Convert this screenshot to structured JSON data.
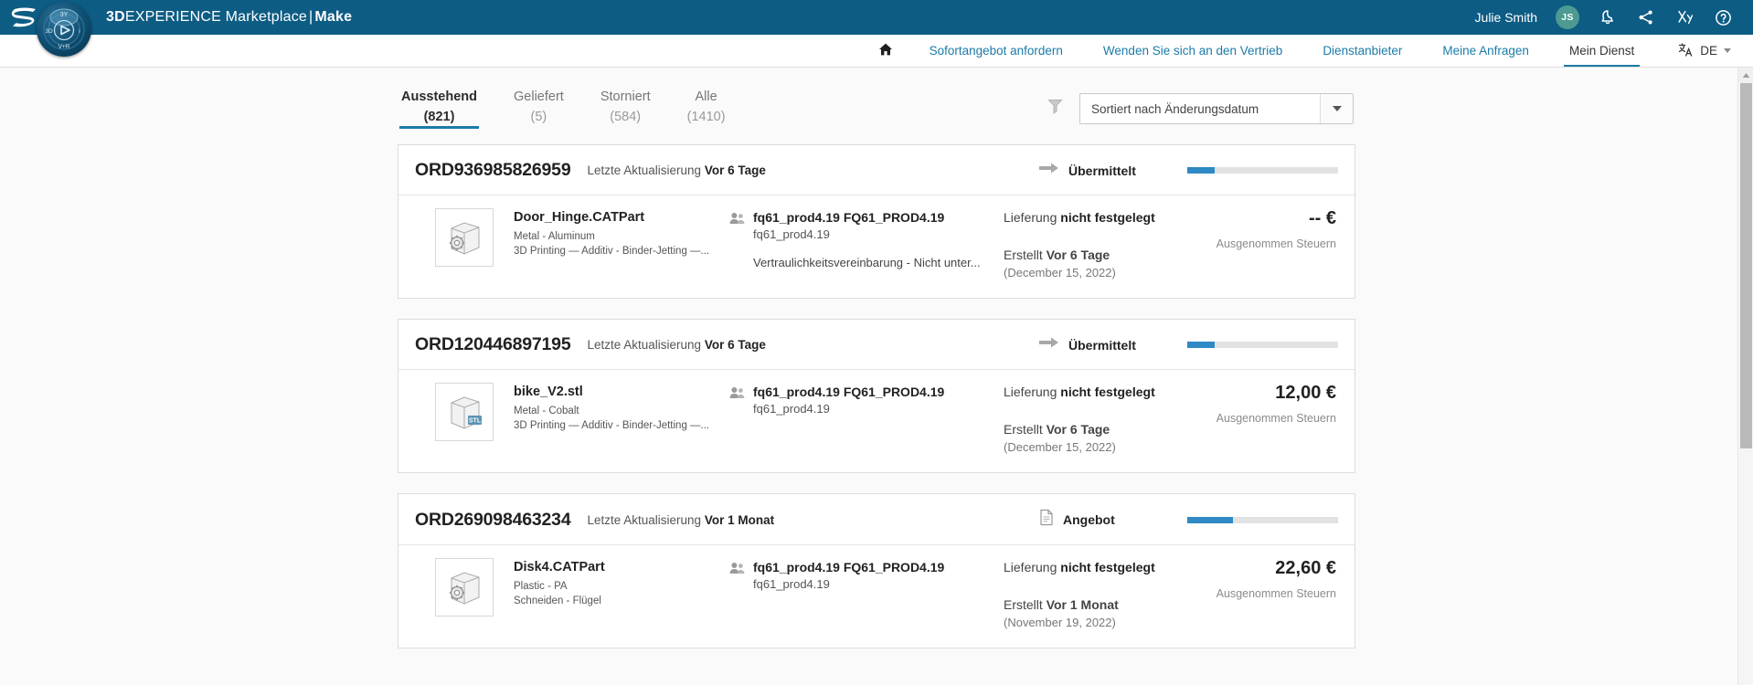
{
  "topbar": {
    "brand_bold": "3D",
    "brand_rest": "EXPERIENCE Marketplace",
    "brand_sep": "|",
    "brand_make": "Make",
    "compass_labels": {
      "top": "3Y",
      "left": "3D",
      "right": "i",
      "bottom": "V+R"
    },
    "user_name": "Julie Smith",
    "avatar_initials": "JS",
    "icons": [
      "notification-bell-icon",
      "share-icon",
      "collaboration-icon",
      "help-icon"
    ],
    "accent": "#0d5c84"
  },
  "nav": {
    "home_icon": "home-icon",
    "items": [
      {
        "label": "Sofortangebot anfordern",
        "active": false
      },
      {
        "label": "Wenden Sie sich an den Vertrieb",
        "active": false
      },
      {
        "label": "Dienstanbieter",
        "active": false
      },
      {
        "label": "Meine Anfragen",
        "active": false
      },
      {
        "label": "Mein Dienst",
        "active": true
      }
    ],
    "language": "DE",
    "language_icon": "translate-icon"
  },
  "tabs": [
    {
      "label": "Ausstehend",
      "count": "(821)",
      "active": true
    },
    {
      "label": "Geliefert",
      "count": "(5)",
      "active": false
    },
    {
      "label": "Storniert",
      "count": "(584)",
      "active": false
    },
    {
      "label": "Alle",
      "count": "(1410)",
      "active": false
    }
  ],
  "toolbar": {
    "filter_icon": "filter-funnel-icon",
    "sort_value": "Sortiert nach Änderungsdatum",
    "sort_placeholder": "Sortiert nach Änderungsdatum",
    "dropdown_icon": "chevron-down-icon"
  },
  "orders": [
    {
      "id": "ORD936985826959",
      "updated_prefix": "Letzte Aktualisierung",
      "updated_value": "Vor 6 Tage",
      "status_icon": "arrow-right-icon",
      "status": "Übermittelt",
      "progress_percent": 18,
      "thumb_icon": "cad-part-icon",
      "thumb_badge": "",
      "product_name": "Door_Hinge.CATPart",
      "material": "Metal - Aluminum",
      "process": "3D Printing — Additiv - Binder-Jetting —...",
      "customer_icon": "customers-icon",
      "customer_main": "fq61_prod4.19 FQ61_PROD4.19",
      "customer_sub": "fq61_prod4.19",
      "nda": "Vertraulichkeitsvereinbarung - Nicht unter...",
      "delivery_prefix": "Lieferung",
      "delivery_value": "nicht festgelegt",
      "created_prefix": "Erstellt",
      "created_value": "Vor 6 Tage",
      "created_date": "(December 15, 2022)",
      "price": "-- €",
      "price_note": "Ausgenommen Steuern"
    },
    {
      "id": "ORD120446897195",
      "updated_prefix": "Letzte Aktualisierung",
      "updated_value": "Vor 6 Tage",
      "status_icon": "arrow-right-icon",
      "status": "Übermittelt",
      "progress_percent": 18,
      "thumb_icon": "stl-part-icon",
      "thumb_badge": "STL",
      "product_name": "bike_V2.stl",
      "material": "Metal - Cobalt",
      "process": "3D Printing — Additiv - Binder-Jetting —...",
      "customer_icon": "customers-icon",
      "customer_main": "fq61_prod4.19 FQ61_PROD4.19",
      "customer_sub": "fq61_prod4.19",
      "nda": "",
      "delivery_prefix": "Lieferung",
      "delivery_value": "nicht festgelegt",
      "created_prefix": "Erstellt",
      "created_value": "Vor 6 Tage",
      "created_date": "(December 15, 2022)",
      "price": "12,00 €",
      "price_note": "Ausgenommen Steuern"
    },
    {
      "id": "ORD269098463234",
      "updated_prefix": "Letzte Aktualisierung",
      "updated_value": "Vor 1 Monat",
      "status_icon": "quote-document-icon",
      "status": "Angebot",
      "progress_percent": 30,
      "thumb_icon": "cad-part-icon",
      "thumb_badge": "",
      "product_name": "Disk4.CATPart",
      "material": "Plastic - PA",
      "process": "Schneiden - Flügel",
      "customer_icon": "customers-icon",
      "customer_main": "fq61_prod4.19 FQ61_PROD4.19",
      "customer_sub": "fq61_prod4.19",
      "nda": "",
      "delivery_prefix": "Lieferung",
      "delivery_value": "nicht festgelegt",
      "created_prefix": "Erstellt",
      "created_value": "Vor 1 Monat",
      "created_date": "(November 19, 2022)",
      "price": "22,60 €",
      "price_note": "Ausgenommen Steuern"
    }
  ],
  "scrollbar": {
    "up_icon": "scroll-up-icon"
  }
}
